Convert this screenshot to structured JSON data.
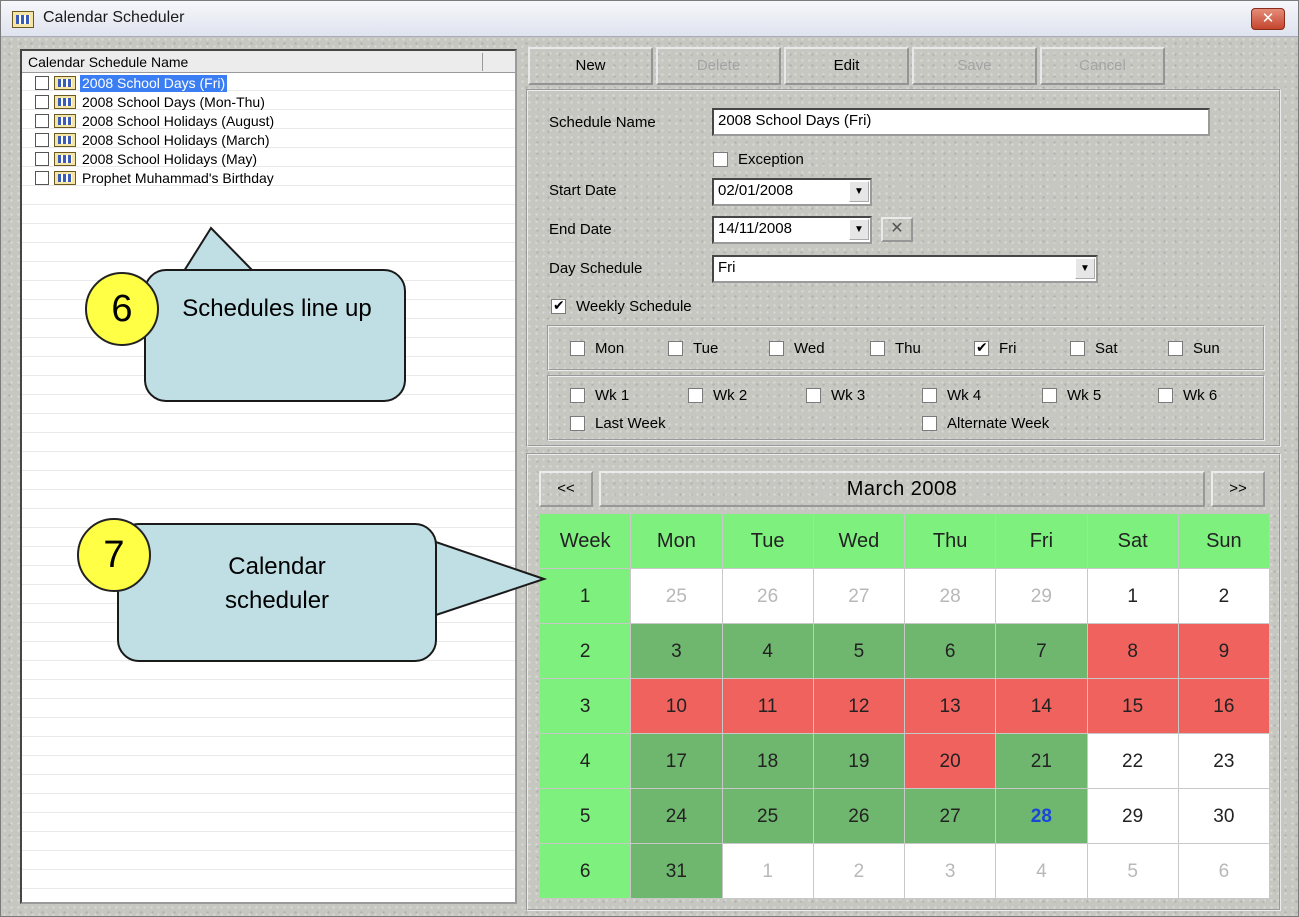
{
  "window": {
    "title": "Calendar Scheduler",
    "close_label": "✕"
  },
  "list": {
    "header": "Calendar Schedule Name",
    "items": [
      {
        "label": "2008 School Days (Fri)",
        "selected": true
      },
      {
        "label": "2008 School Days (Mon-Thu)",
        "selected": false
      },
      {
        "label": "2008 School Holidays (August)",
        "selected": false
      },
      {
        "label": "2008 School Holidays (March)",
        "selected": false
      },
      {
        "label": "2008 School Holidays (May)",
        "selected": false
      },
      {
        "label": "Prophet Muhammad's Birthday",
        "selected": false
      }
    ]
  },
  "toolbar": {
    "new": "New",
    "delete": "Delete",
    "edit": "Edit",
    "save": "Save",
    "cancel": "Cancel"
  },
  "form": {
    "schedule_name_label": "Schedule Name",
    "schedule_name_value": "2008 School Days (Fri)",
    "exception_label": "Exception",
    "start_date_label": "Start Date",
    "start_date_value": "02/01/2008",
    "end_date_label": "End Date",
    "end_date_value": "14/11/2008",
    "day_schedule_label": "Day Schedule",
    "day_schedule_value": "Fri",
    "weekly_label": "Weekly Schedule",
    "days": [
      {
        "label": "Mon",
        "checked": false
      },
      {
        "label": "Tue",
        "checked": false
      },
      {
        "label": "Wed",
        "checked": false
      },
      {
        "label": "Thu",
        "checked": false
      },
      {
        "label": "Fri",
        "checked": true
      },
      {
        "label": "Sat",
        "checked": false
      },
      {
        "label": "Sun",
        "checked": false
      }
    ],
    "weeks": [
      "Wk 1",
      "Wk 2",
      "Wk 3",
      "Wk 4",
      "Wk 5",
      "Wk 6"
    ],
    "last_week_label": "Last Week",
    "alternate_week_label": "Alternate Week",
    "clear_label": "✕",
    "dropdown_arrow": "▼"
  },
  "calendar": {
    "prev_label": "<<",
    "next_label": ">>",
    "month_label": "March  2008",
    "headers": [
      "Week",
      "Mon",
      "Tue",
      "Wed",
      "Thu",
      "Fri",
      "Sat",
      "Sun"
    ],
    "rows": [
      {
        "week": "1",
        "days": [
          [
            "25",
            "other"
          ],
          [
            "26",
            "other"
          ],
          [
            "27",
            "other"
          ],
          [
            "28",
            "other"
          ],
          [
            "29",
            "other"
          ],
          [
            "1",
            "plain"
          ],
          [
            "2",
            "plain"
          ]
        ]
      },
      {
        "week": "2",
        "days": [
          [
            "3",
            "school"
          ],
          [
            "4",
            "school"
          ],
          [
            "5",
            "school"
          ],
          [
            "6",
            "school"
          ],
          [
            "7",
            "school"
          ],
          [
            "8",
            "holiday"
          ],
          [
            "9",
            "holiday"
          ]
        ]
      },
      {
        "week": "3",
        "days": [
          [
            "10",
            "holiday"
          ],
          [
            "11",
            "holiday"
          ],
          [
            "12",
            "holiday"
          ],
          [
            "13",
            "holiday"
          ],
          [
            "14",
            "holiday"
          ],
          [
            "15",
            "holiday"
          ],
          [
            "16",
            "holiday"
          ]
        ]
      },
      {
        "week": "4",
        "days": [
          [
            "17",
            "school"
          ],
          [
            "18",
            "school"
          ],
          [
            "19",
            "school"
          ],
          [
            "20",
            "holiday"
          ],
          [
            "21",
            "school"
          ],
          [
            "22",
            "plain"
          ],
          [
            "23",
            "plain"
          ]
        ]
      },
      {
        "week": "5",
        "days": [
          [
            "24",
            "school"
          ],
          [
            "25",
            "school"
          ],
          [
            "26",
            "school"
          ],
          [
            "27",
            "school"
          ],
          [
            "28",
            "today"
          ],
          [
            "29",
            "plain"
          ],
          [
            "30",
            "plain"
          ]
        ]
      },
      {
        "week": "6",
        "days": [
          [
            "31",
            "school"
          ],
          [
            "1",
            "other"
          ],
          [
            "2",
            "other"
          ],
          [
            "3",
            "other"
          ],
          [
            "4",
            "other"
          ],
          [
            "5",
            "other"
          ],
          [
            "6",
            "other"
          ]
        ]
      }
    ]
  },
  "callouts": {
    "six_number": "6",
    "six_text": "Schedules line up",
    "seven_number": "7",
    "seven_text": "Calendar scheduler"
  }
}
